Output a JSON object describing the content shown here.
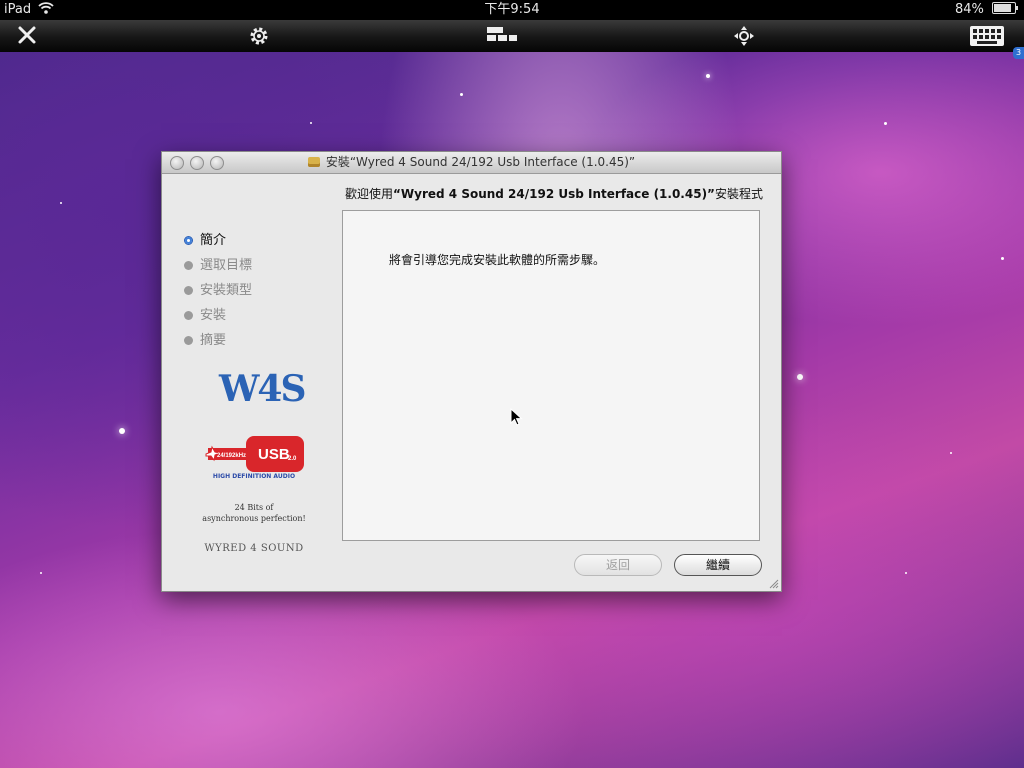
{
  "status_bar": {
    "device": "iPad",
    "time": "下午9:54",
    "battery": "84%",
    "battery_level": 0.84
  },
  "toolbar": {
    "icons": [
      "close-icon",
      "gear-icon",
      "display-layout-icon",
      "move-arrows-icon",
      "keyboard-icon"
    ]
  },
  "window": {
    "title": "安裝“Wyred 4 Sound 24/192 Usb Interface (1.0.45)”",
    "heading_prefix": "歡迎使用",
    "heading_bold": "“Wyred 4 Sound 24/192 Usb Interface (1.0.45)”",
    "heading_suffix": "安裝程式",
    "steps": [
      {
        "label": "簡介",
        "active": true
      },
      {
        "label": "選取目標",
        "active": false
      },
      {
        "label": "安裝類型",
        "active": false
      },
      {
        "label": "安裝",
        "active": false
      },
      {
        "label": "摘要",
        "active": false
      }
    ],
    "logo": {
      "w4s": "W4S",
      "usb_rate": "24/192kHz",
      "usb": "USB",
      "usb_version": "2.0",
      "hd_audio": "HIGH DEFINITION AUDIO",
      "tagline_line1": "24 Bits of",
      "tagline_line2": "asynchronous perfection!",
      "brand": "WYRED 4 SOUND"
    },
    "body_text": "將會引導您完成安裝此軟體的所需步驟。",
    "buttons": {
      "back": "返回",
      "continue": "繼續"
    }
  },
  "colors": {
    "accent_blue": "#2b63b5",
    "usb_red": "#d9262b"
  }
}
